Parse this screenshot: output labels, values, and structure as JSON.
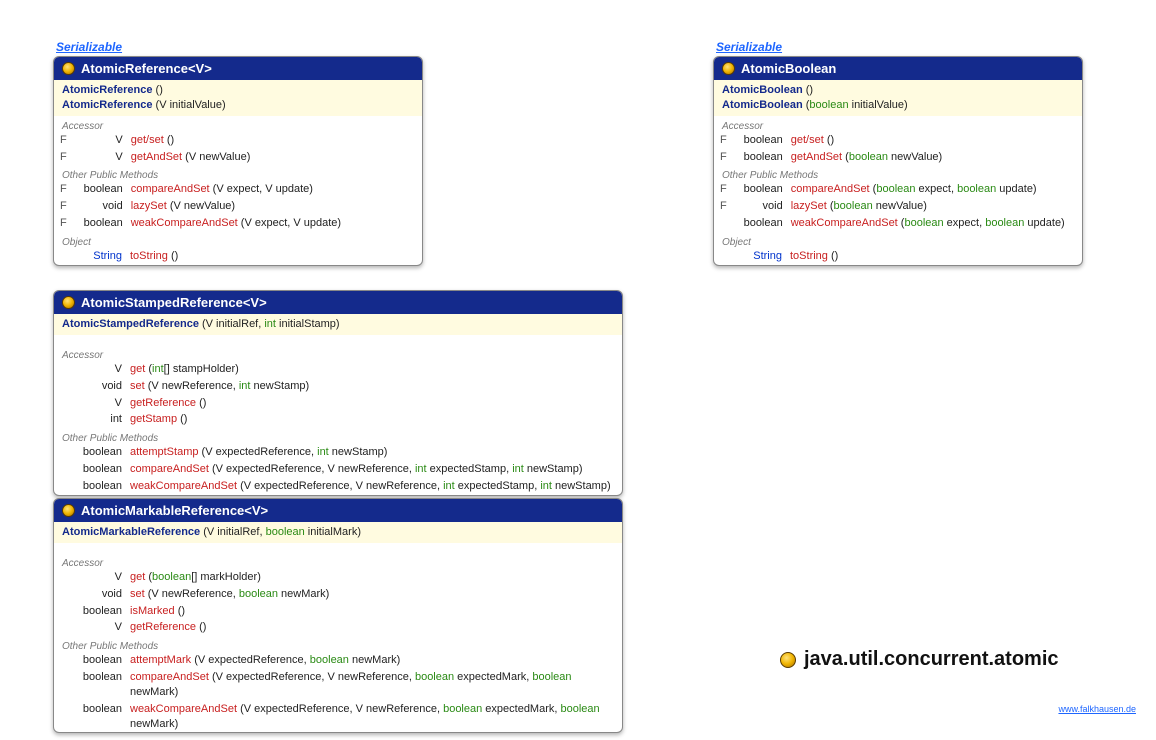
{
  "packageTitle": "java.util.concurrent.atomic",
  "footerUrl": "www.falkhausen.de",
  "labels": {
    "serializable": "Serializable",
    "accessor": "Accessor",
    "otherPublicMethods": "Other Public Methods",
    "object": "Object"
  },
  "classes": {
    "atomicReference": {
      "name": "AtomicReference",
      "typeParam": "<V>",
      "implementsSerializable": true,
      "constructors": [
        {
          "name": "AtomicReference",
          "params": "()"
        },
        {
          "name": "AtomicReference",
          "params": "(V initialValue)"
        }
      ],
      "accessor": [
        {
          "mod": "F",
          "ret": "V",
          "name": "get/set",
          "params": "()"
        },
        {
          "mod": "F",
          "ret": "V",
          "name": "getAndSet",
          "params": "(V newValue)"
        }
      ],
      "otherPublic": [
        {
          "mod": "F",
          "ret": "boolean",
          "name": "compareAndSet",
          "params": "(V expect, V update)"
        },
        {
          "mod": "F",
          "ret": "void",
          "name": "lazySet",
          "params": "(V newValue)"
        },
        {
          "mod": "F",
          "ret": "boolean",
          "name": "weakCompareAndSet",
          "params": "(V expect, V update)"
        }
      ],
      "objectMethods": [
        {
          "mod": "",
          "ret": "String",
          "retLink": true,
          "name": "toString",
          "params": "()"
        }
      ]
    },
    "atomicBoolean": {
      "name": "AtomicBoolean",
      "typeParam": "",
      "implementsSerializable": true,
      "constructors": [
        {
          "name": "AtomicBoolean",
          "params": "()"
        },
        {
          "name": "AtomicBoolean",
          "paramsParts": [
            "(",
            {
              "kw": "boolean"
            },
            " initialValue)"
          ]
        }
      ],
      "accessor": [
        {
          "mod": "F",
          "ret": "boolean",
          "name": "get/set",
          "params": "()"
        },
        {
          "mod": "F",
          "ret": "boolean",
          "name": "getAndSet",
          "paramsParts": [
            "(",
            {
              "kw": "boolean"
            },
            " newValue)"
          ]
        }
      ],
      "otherPublic": [
        {
          "mod": "F",
          "ret": "boolean",
          "name": "compareAndSet",
          "paramsParts": [
            "(",
            {
              "kw": "boolean"
            },
            " expect, ",
            {
              "kw": "boolean"
            },
            " update)"
          ]
        },
        {
          "mod": "F",
          "ret": "void",
          "name": "lazySet",
          "paramsParts": [
            "(",
            {
              "kw": "boolean"
            },
            " newValue)"
          ]
        },
        {
          "mod": "",
          "ret": "boolean",
          "name": "weakCompareAndSet",
          "paramsParts": [
            "(",
            {
              "kw": "boolean"
            },
            " expect, ",
            {
              "kw": "boolean"
            },
            " update)"
          ]
        }
      ],
      "objectMethods": [
        {
          "mod": "",
          "ret": "String",
          "retLink": true,
          "name": "toString",
          "params": "()"
        }
      ]
    },
    "atomicStampedReference": {
      "name": "AtomicStampedReference",
      "typeParam": "<V>",
      "implementsSerializable": false,
      "constructors": [
        {
          "name": "AtomicStampedReference",
          "paramsParts": [
            "(V initialRef, ",
            {
              "kw": "int"
            },
            " initialStamp)"
          ]
        }
      ],
      "accessor": [
        {
          "mod": "",
          "ret": "V",
          "name": "get",
          "paramsParts": [
            "(",
            {
              "kw": "int"
            },
            "[] stampHolder)"
          ]
        },
        {
          "mod": "",
          "ret": "void",
          "name": "set",
          "paramsParts": [
            "(V newReference, ",
            {
              "kw": "int"
            },
            " newStamp)"
          ]
        },
        {
          "mod": "",
          "ret": "V",
          "name": "getReference",
          "params": "()"
        },
        {
          "mod": "",
          "ret": "int",
          "name": "getStamp",
          "params": "()"
        }
      ],
      "otherPublic": [
        {
          "mod": "",
          "ret": "boolean",
          "name": "attemptStamp",
          "paramsParts": [
            "(V expectedReference, ",
            {
              "kw": "int"
            },
            " newStamp)"
          ]
        },
        {
          "mod": "",
          "ret": "boolean",
          "name": "compareAndSet",
          "paramsParts": [
            "(V expectedReference, V newReference, ",
            {
              "kw": "int"
            },
            " expectedStamp, ",
            {
              "kw": "int"
            },
            " newStamp)"
          ]
        },
        {
          "mod": "",
          "ret": "boolean",
          "name": "weakCompareAndSet",
          "paramsParts": [
            "(V expectedReference, V newReference, ",
            {
              "kw": "int"
            },
            " expectedStamp, ",
            {
              "kw": "int"
            },
            " newStamp)"
          ]
        }
      ],
      "objectMethods": []
    },
    "atomicMarkableReference": {
      "name": "AtomicMarkableReference",
      "typeParam": "<V>",
      "implementsSerializable": false,
      "constructors": [
        {
          "name": "AtomicMarkableReference",
          "paramsParts": [
            "(V initialRef, ",
            {
              "kw": "boolean"
            },
            " initialMark)"
          ]
        }
      ],
      "accessor": [
        {
          "mod": "",
          "ret": "V",
          "name": "get",
          "paramsParts": [
            "(",
            {
              "kw": "boolean"
            },
            "[] markHolder)"
          ]
        },
        {
          "mod": "",
          "ret": "void",
          "name": "set",
          "paramsParts": [
            "(V newReference, ",
            {
              "kw": "boolean"
            },
            " newMark)"
          ]
        },
        {
          "mod": "",
          "ret": "boolean",
          "name": "isMarked",
          "params": "()"
        },
        {
          "mod": "",
          "ret": "V",
          "name": "getReference",
          "params": "()"
        }
      ],
      "otherPublic": [
        {
          "mod": "",
          "ret": "boolean",
          "name": "attemptMark",
          "paramsParts": [
            "(V expectedReference, ",
            {
              "kw": "boolean"
            },
            " newMark)"
          ]
        },
        {
          "mod": "",
          "ret": "boolean",
          "name": "compareAndSet",
          "paramsParts": [
            "(V expectedReference, V newReference, ",
            {
              "kw": "boolean"
            },
            " expectedMark, ",
            {
              "kw": "boolean"
            },
            " newMark)"
          ]
        },
        {
          "mod": "",
          "ret": "boolean",
          "name": "weakCompareAndSet",
          "paramsParts": [
            "(V expectedReference, V newReference, ",
            {
              "kw": "boolean"
            },
            " expectedMark, ",
            {
              "kw": "boolean"
            },
            " newMark)"
          ]
        }
      ],
      "objectMethods": []
    }
  }
}
